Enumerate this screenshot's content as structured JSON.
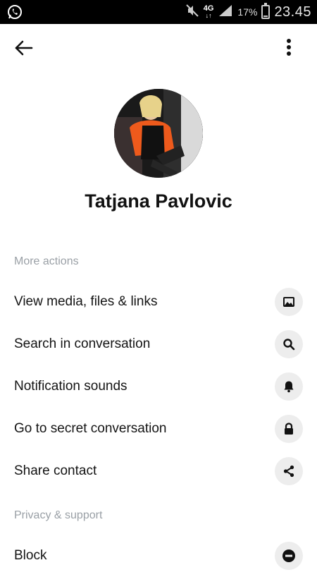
{
  "status_bar": {
    "network": "4G",
    "battery": "17%",
    "time": "23.45",
    "battery_level": 0.17
  },
  "profile": {
    "name": "Tatjana Pavlovic"
  },
  "sections": {
    "more_actions": {
      "title": "More actions",
      "items": [
        {
          "label": "View media, files & links",
          "icon": "image-icon"
        },
        {
          "label": "Search in conversation",
          "icon": "search-icon"
        },
        {
          "label": "Notification sounds",
          "icon": "bell-icon"
        },
        {
          "label": "Go to secret conversation",
          "icon": "lock-icon"
        },
        {
          "label": "Share contact",
          "icon": "share-icon"
        }
      ]
    },
    "privacy_support": {
      "title": "Privacy & support",
      "items": [
        {
          "label": "Block",
          "icon": "block-icon"
        }
      ]
    }
  }
}
